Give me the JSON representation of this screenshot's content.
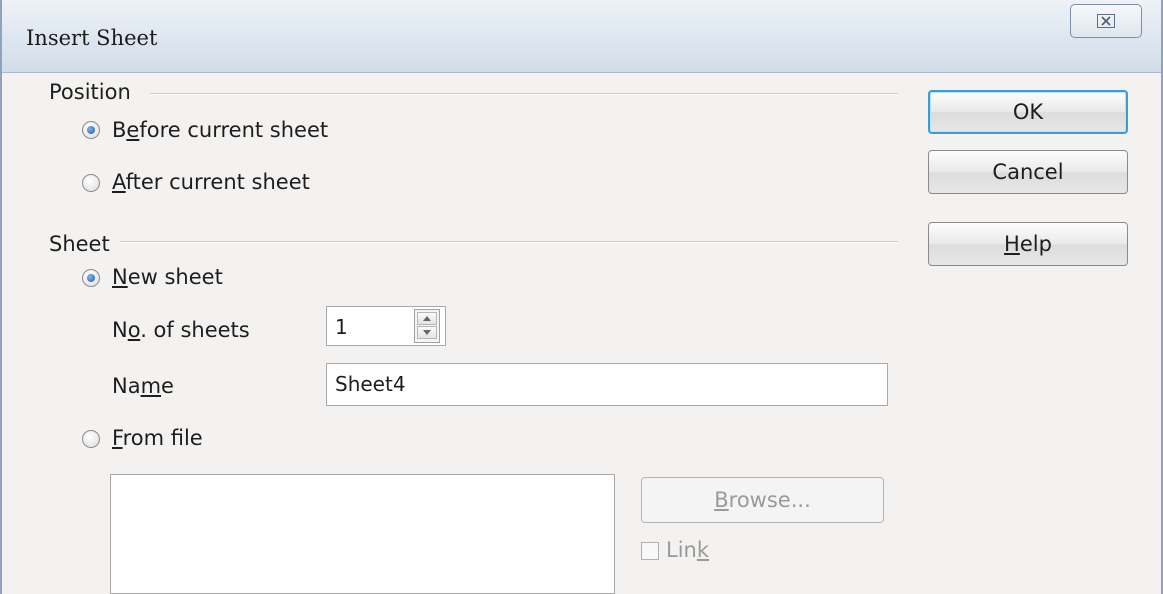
{
  "window": {
    "title": "Insert Sheet",
    "close_glyph": "⌧"
  },
  "position": {
    "label": "Position",
    "before": {
      "pre": "B",
      "ul": "e",
      "post": "fore current sheet",
      "selected": true
    },
    "after": {
      "pre": "",
      "ul": "A",
      "post": "fter current sheet",
      "selected": false
    }
  },
  "sheet": {
    "label": "Sheet",
    "new_sheet": {
      "pre": "",
      "ul": "N",
      "post": "ew sheet",
      "selected": true
    },
    "num_sheets": {
      "pre": "N",
      "ul": "o",
      "post": ". of sheets",
      "value": "1"
    },
    "name": {
      "pre": "Na",
      "ul": "m",
      "post": "e",
      "value": "Sheet4"
    },
    "from_file": {
      "pre": "",
      "ul": "F",
      "post": "rom file",
      "selected": false
    },
    "browse": {
      "pre": "",
      "ul": "B",
      "post": "rowse..."
    },
    "link": {
      "pre": "Lin",
      "ul": "k",
      "post": ""
    }
  },
  "buttons": {
    "ok": "OK",
    "cancel": "Cancel",
    "help": {
      "pre": "",
      "ul": "H",
      "post": "elp"
    }
  }
}
